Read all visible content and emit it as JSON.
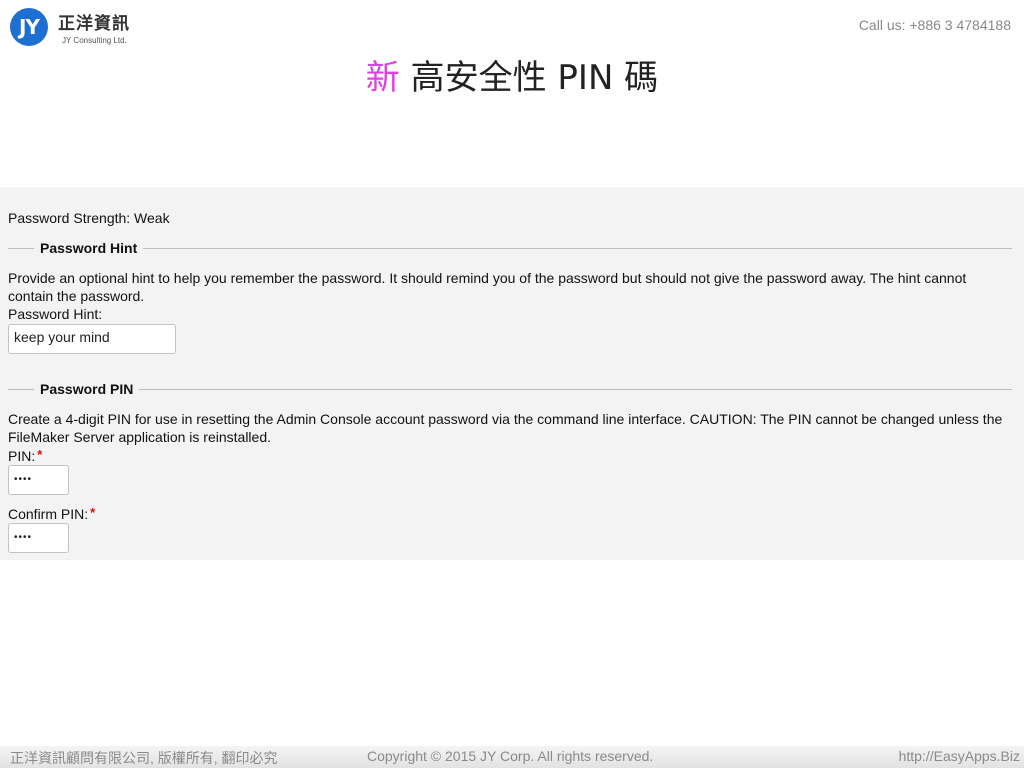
{
  "header": {
    "logo_mark": "JY",
    "logo_name": "正洋資訊",
    "logo_sub": "JY Consulting Ltd.",
    "call": "Call us: +886 3 4784188"
  },
  "title": {
    "highlight": "新",
    "rest": " 高安全性 PIN 碼"
  },
  "form": {
    "strength": "Password Strength: Weak",
    "hint_section": {
      "legend": "Password Hint",
      "description": "Provide an optional hint to help you remember the password. It should remind you of the password but should not give the password away. The hint cannot contain the password.",
      "field_label": "Password Hint:",
      "value": "keep your mind"
    },
    "pin_section": {
      "legend": "Password PIN",
      "description": "Create a 4-digit PIN for use in resetting the Admin Console account password via the command line interface. CAUTION: The PIN cannot be changed unless the FileMaker Server application is reinstalled.",
      "pin_label": "PIN:",
      "pin_value": "••••",
      "confirm_label": "Confirm PIN:",
      "confirm_value": "••••",
      "required_mark": "*"
    }
  },
  "footer": {
    "left": "正洋資訊顧問有限公司, 版權所有, 翻印必究",
    "center": "Copyright © 2015 JY Corp. All rights reserved.",
    "right": "http://EasyApps.Biz"
  },
  "colors": {
    "accent": "#1d6fd1",
    "title_highlight": "#e040e0",
    "required": "#d01010",
    "panel_bg": "#f3f3f3"
  }
}
